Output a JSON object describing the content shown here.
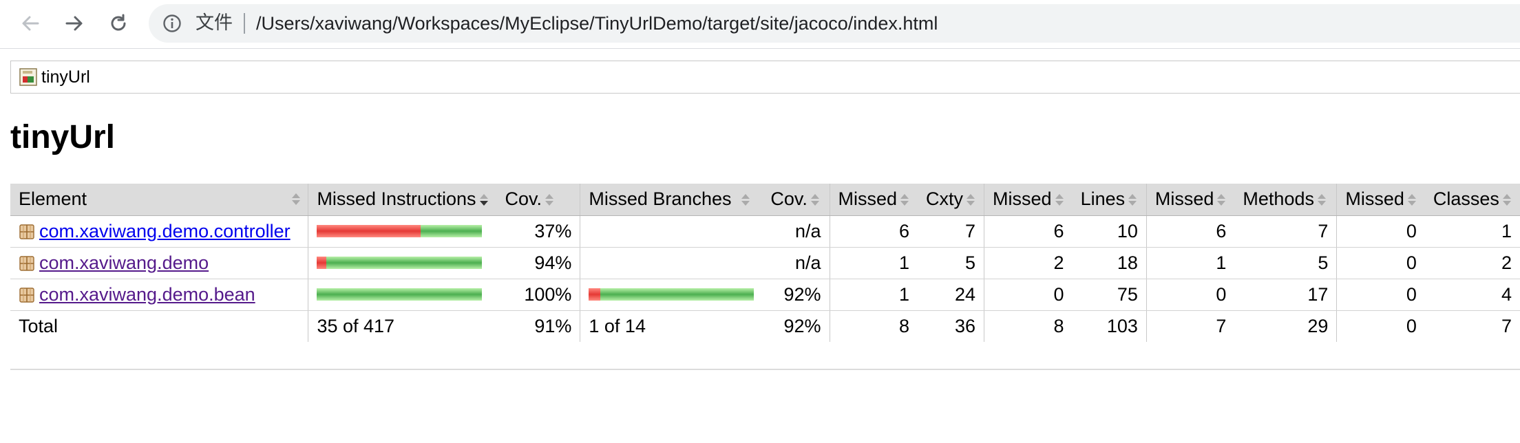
{
  "browser": {
    "scheme_label": "文件",
    "url": "/Users/xaviwang/Workspaces/MyEclipse/TinyUrlDemo/target/site/jacoco/index.html"
  },
  "breadcrumb": {
    "label": "tinyUrl"
  },
  "page_title": "tinyUrl",
  "table": {
    "headers": [
      "Element",
      "Missed Instructions",
      "Cov.",
      "Missed Branches",
      "Cov.",
      "Missed",
      "Cxty",
      "Missed",
      "Lines",
      "Missed",
      "Methods",
      "Missed",
      "Classes"
    ],
    "rows": [
      {
        "element": "com.xaviwang.demo.controller",
        "instr_missed_fraction": 0.63,
        "instr_cov": "37%",
        "branch_missed_fraction": null,
        "branch_cov": "n/a",
        "cxty_missed": "6",
        "cxty": "7",
        "lines_missed": "6",
        "lines": "10",
        "methods_missed": "6",
        "methods": "7",
        "classes_missed": "0",
        "classes": "1",
        "visited": false
      },
      {
        "element": "com.xaviwang.demo",
        "instr_missed_fraction": 0.06,
        "instr_cov": "94%",
        "branch_missed_fraction": null,
        "branch_cov": "n/a",
        "cxty_missed": "1",
        "cxty": "5",
        "lines_missed": "2",
        "lines": "18",
        "methods_missed": "1",
        "methods": "5",
        "classes_missed": "0",
        "classes": "2",
        "visited": true
      },
      {
        "element": "com.xaviwang.demo.bean",
        "instr_missed_fraction": 0.0,
        "instr_cov": "100%",
        "branch_missed_fraction": 0.07,
        "branch_cov": "92%",
        "cxty_missed": "1",
        "cxty": "24",
        "lines_missed": "0",
        "lines": "75",
        "methods_missed": "0",
        "methods": "17",
        "classes_missed": "0",
        "classes": "4",
        "visited": true
      }
    ],
    "total": {
      "label": "Total",
      "instr": "35 of 417",
      "instr_cov": "91%",
      "branch": "1 of 14",
      "branch_cov": "92%",
      "cxty_missed": "8",
      "cxty": "36",
      "lines_missed": "8",
      "lines": "103",
      "methods_missed": "7",
      "methods": "29",
      "classes_missed": "0",
      "classes": "7"
    }
  },
  "colors": {
    "bar_red": "#e53935",
    "bar_green": "#4caf50",
    "header_bg": "#dcdcdc",
    "link": "#0000ee",
    "visited": "#551a8b"
  }
}
